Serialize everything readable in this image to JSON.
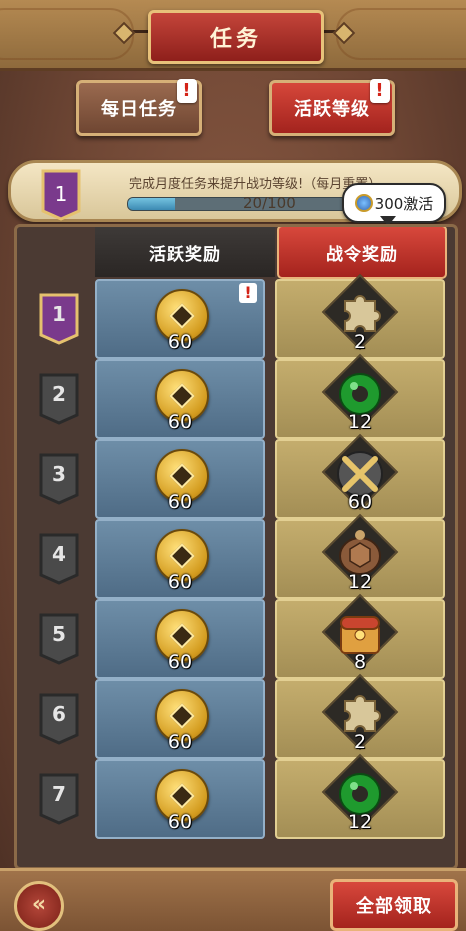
{
  "header": {
    "title": "任务"
  },
  "tabs": [
    {
      "label": "每日任务",
      "badge": "!"
    },
    {
      "label": "活跃等级",
      "badge": "!"
    }
  ],
  "progress": {
    "level": "1",
    "description": "完成月度任务来提升战功等级!（每月重置）",
    "current_text": "20/100",
    "fraction": 0.2
  },
  "bubble": {
    "label": "300激活"
  },
  "columns": {
    "free": "活跃奖励",
    "battle": "战令奖励"
  },
  "rows": [
    {
      "level": "1",
      "free_amount": "60",
      "free_badge": "!",
      "paid_item": "puzzle-piece-icon",
      "paid_amount": "2",
      "unlocked": true
    },
    {
      "level": "2",
      "free_amount": "60",
      "paid_item": "jade-ring-icon",
      "paid_amount": "12",
      "unlocked": false
    },
    {
      "level": "3",
      "free_amount": "60",
      "paid_item": "crossed-swords-icon",
      "paid_amount": "60",
      "unlocked": false
    },
    {
      "level": "4",
      "free_amount": "60",
      "paid_item": "turtle-shell-icon",
      "paid_amount": "12",
      "unlocked": false
    },
    {
      "level": "5",
      "free_amount": "60",
      "paid_item": "treasure-chest-icon",
      "paid_amount": "8",
      "unlocked": false
    },
    {
      "level": "6",
      "free_amount": "60",
      "paid_item": "puzzle-piece-icon",
      "paid_amount": "2",
      "unlocked": false
    },
    {
      "level": "7",
      "free_amount": "60",
      "paid_item": "jade-ring-icon",
      "paid_amount": "12",
      "unlocked": false
    }
  ],
  "footer": {
    "back_icon": "back-arrow-icon",
    "claim_all": "全部领取"
  },
  "colors": {
    "accent_red": "#c4302a",
    "free_cell": "#5e7d97",
    "paid_cell": "#b39e61",
    "unlocked_flag": "#7a3a8c",
    "locked_flag": "#4a4a4a"
  }
}
